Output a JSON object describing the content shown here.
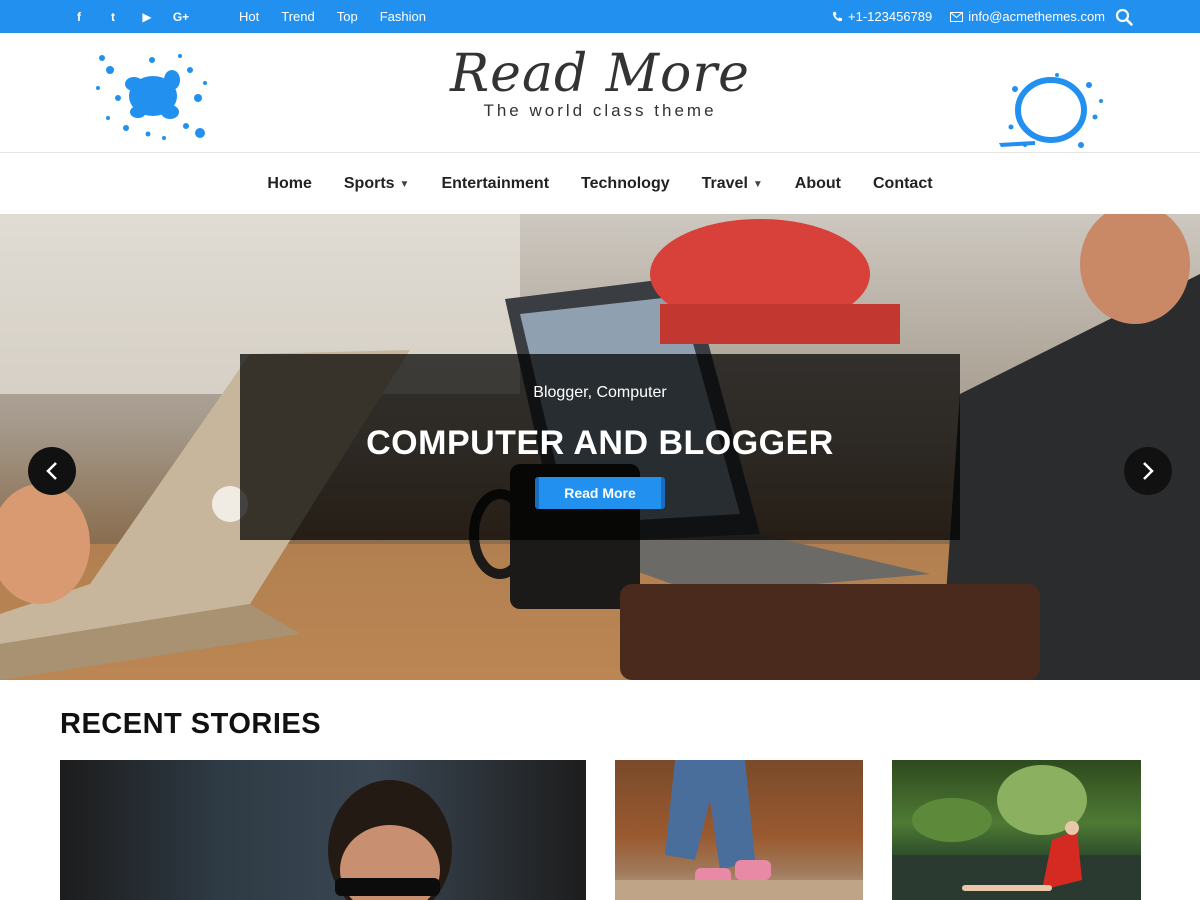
{
  "topbar": {
    "social": [
      {
        "name": "facebook-icon",
        "glyph": "f"
      },
      {
        "name": "twitter-icon",
        "glyph": "t"
      },
      {
        "name": "youtube-icon",
        "glyph": "▶"
      },
      {
        "name": "googleplus-icon",
        "glyph": "G+"
      }
    ],
    "links": [
      "Hot",
      "Trend",
      "Top",
      "Fashion"
    ],
    "phone": "+1-123456789",
    "email": "info@acmethemes.com"
  },
  "header": {
    "site_title": "Read More",
    "tagline": "The world class theme"
  },
  "nav": {
    "items": [
      {
        "label": "Home",
        "dropdown": false
      },
      {
        "label": "Sports",
        "dropdown": true
      },
      {
        "label": "Entertainment",
        "dropdown": false
      },
      {
        "label": "Technology",
        "dropdown": false
      },
      {
        "label": "Travel",
        "dropdown": true
      },
      {
        "label": "About",
        "dropdown": false
      },
      {
        "label": "Contact",
        "dropdown": false
      }
    ]
  },
  "slider": {
    "category": "Blogger, Computer",
    "title": "COMPUTER AND BLOGGER",
    "button": "Read More"
  },
  "recent": {
    "title": "RECENT STORIES"
  },
  "colors": {
    "accent": "#2290ef"
  }
}
